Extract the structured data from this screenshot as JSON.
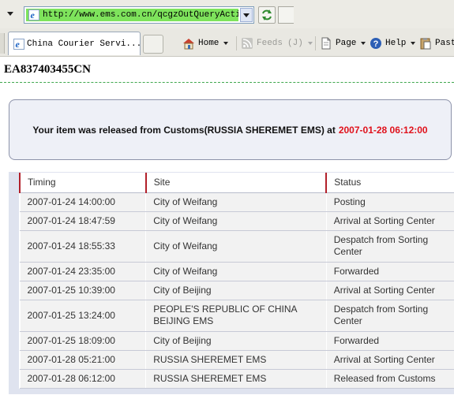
{
  "browser": {
    "address": "http://www.ems.com.cn/qcgzOutQueryAction.d",
    "tab_title": "China Courier Servi...",
    "commands": {
      "home": "Home",
      "feeds": "Feeds",
      "feeds_count": "(J)",
      "page": "Page",
      "help": "Help",
      "paste": "Past"
    },
    "icons": [
      "ie-page-icon",
      "refresh-icon",
      "home-icon",
      "feeds-icon",
      "page-icon",
      "help-icon",
      "paste-icon"
    ]
  },
  "tracking": {
    "number": "EA837403455CN",
    "status_message": "Your item was released from Customs(RUSSIA SHEREMET EMS) at",
    "status_time": "2007-01-28 06:12:00"
  },
  "table": {
    "headers": [
      "Timing",
      "Site",
      "Status"
    ],
    "rows": [
      {
        "timing": "2007-01-24  14:00:00",
        "site": "City of Weifang",
        "status": "Posting"
      },
      {
        "timing": "2007-01-24  18:47:59",
        "site": "City of Weifang",
        "status": "Arrival at Sorting Center"
      },
      {
        "timing": "2007-01-24  18:55:33",
        "site": "City of Weifang",
        "status": "Despatch from Sorting Center"
      },
      {
        "timing": "2007-01-24  23:35:00",
        "site": "City of Weifang",
        "status": "Forwarded"
      },
      {
        "timing": "2007-01-25  10:39:00",
        "site": "City of Beijing",
        "status": "Arrival at Sorting Center"
      },
      {
        "timing": "2007-01-25  13:24:00",
        "site": "PEOPLE'S REPUBLIC OF CHINA BEIJING EMS",
        "status": "Despatch from Sorting Center"
      },
      {
        "timing": "2007-01-25  18:09:00",
        "site": "City of Beijing",
        "status": "Forwarded"
      },
      {
        "timing": "2007-01-28  05:21:00",
        "site": "RUSSIA SHEREMET EMS",
        "status": "Arrival at Sorting Center"
      },
      {
        "timing": "2007-01-28  06:12:00",
        "site": "RUSSIA SHEREMET EMS",
        "status": "Released from Customs"
      }
    ]
  },
  "colors": {
    "status_time": "#e0121c",
    "header_rule": "#b2202a",
    "address_highlight": "#7ee35c",
    "divider": "#3fa74d"
  }
}
